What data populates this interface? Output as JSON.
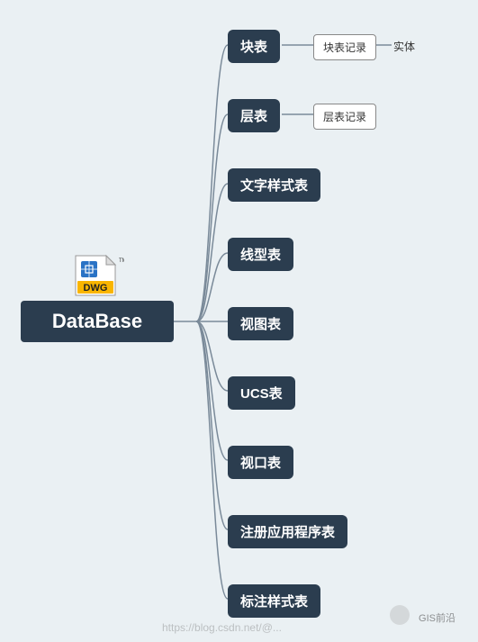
{
  "root": {
    "label": "DataBase"
  },
  "children": [
    {
      "label": "块表",
      "idx": 0,
      "leaves": [
        {
          "label": "块表记录"
        },
        {
          "label": "实体"
        }
      ]
    },
    {
      "label": "层表",
      "idx": 1,
      "leaves": [
        {
          "label": "层表记录"
        }
      ]
    },
    {
      "label": "文字样式表",
      "idx": 2,
      "leaves": []
    },
    {
      "label": "线型表",
      "idx": 3,
      "leaves": []
    },
    {
      "label": "视图表",
      "idx": 4,
      "leaves": []
    },
    {
      "label": "UCS表",
      "idx": 5,
      "leaves": []
    },
    {
      "label": "视口表",
      "idx": 6,
      "leaves": []
    },
    {
      "label": "注册应用程序表",
      "idx": 7,
      "leaves": []
    },
    {
      "label": "标注样式表",
      "idx": 8,
      "leaves": []
    }
  ],
  "icon": {
    "label": "DWG",
    "tm": "TM"
  },
  "watermark": {
    "link": "https://blog.csdn.net/@...",
    "gis": "GIS前沿"
  }
}
